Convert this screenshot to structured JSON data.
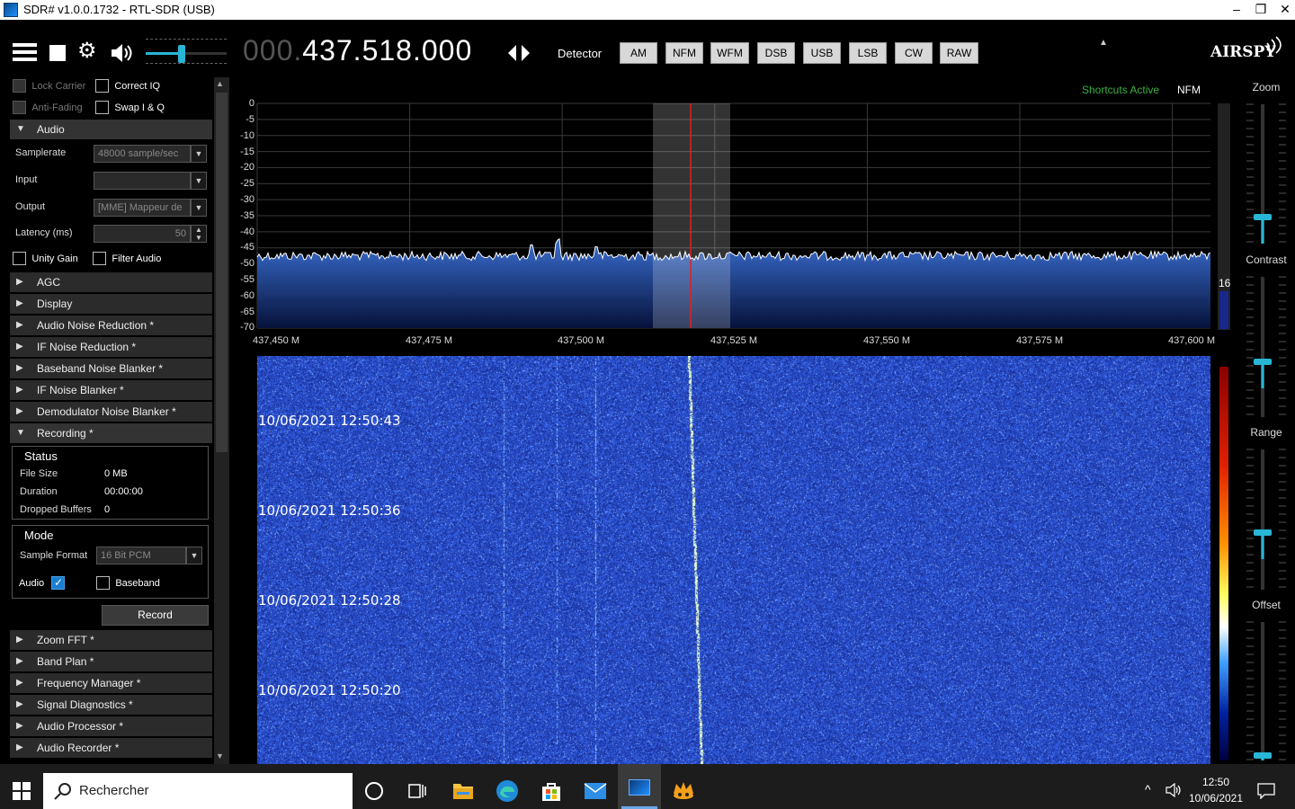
{
  "window": {
    "title": "SDR# v1.0.0.1732 - RTL-SDR (USB)",
    "minimize": "–",
    "restore": "❐",
    "close": "✕"
  },
  "toolbar": {
    "freq_dim": "000.",
    "freq_main": "437.518.000",
    "detector_label": "Detector",
    "modes": [
      "AM",
      "NFM",
      "WFM",
      "DSB",
      "USB",
      "LSB",
      "CW",
      "RAW"
    ],
    "logo": "AIRSPY",
    "volume_level": 0.5
  },
  "left": {
    "lock_carrier": "Lock Carrier",
    "correct_iq": "Correct IQ",
    "anti_fading": "Anti-Fading",
    "swap_iq": "Swap I & Q",
    "audio_header": "Audio",
    "samplerate_label": "Samplerate",
    "samplerate_value": "48000 sample/sec",
    "input_label": "Input",
    "input_value": "",
    "output_label": "Output",
    "output_value": "[MME] Mappeur de",
    "latency_label": "Latency (ms)",
    "latency_value": "50",
    "unity_gain": "Unity Gain",
    "filter_audio": "Filter Audio",
    "sections_a": [
      "AGC",
      "Display",
      "Audio Noise Reduction *",
      "IF Noise Reduction *",
      "Baseband Noise Blanker *",
      "IF Noise Blanker *",
      "Demodulator Noise Blanker *"
    ],
    "recording_header": "Recording *",
    "status_title": "Status",
    "file_size_label": "File Size",
    "file_size_value": "0 MB",
    "duration_label": "Duration",
    "duration_value": "00:00:00",
    "dropped_label": "Dropped Buffers",
    "dropped_value": "0",
    "mode_title": "Mode",
    "sample_format_label": "Sample Format",
    "sample_format_value": "16 Bit PCM",
    "audio_cb": "Audio",
    "baseband_cb": "Baseband",
    "record_button": "Record",
    "sections_b": [
      "Zoom FFT *",
      "Band Plan *",
      "Frequency Manager *",
      "Signal Diagnostics *",
      "Audio Processor *",
      "Audio Recorder *"
    ]
  },
  "spectrum": {
    "shortcuts": "Shortcuts Active",
    "mode": "NFM",
    "y_ticks": [
      "0",
      "-5",
      "-10",
      "-15",
      "-20",
      "-25",
      "-30",
      "-35",
      "-40",
      "-45",
      "-50",
      "-55",
      "-60",
      "-65",
      "-70"
    ],
    "x_ticks": [
      "437,450 M",
      "437,475 M",
      "437,500 M",
      "437,525 M",
      "437,550 M",
      "437,575 M",
      "437,600 M"
    ],
    "side_value": "16"
  },
  "waterfall": {
    "timestamps": [
      "10/06/2021 12:50:43",
      "10/06/2021 12:50:36",
      "10/06/2021 12:50:28",
      "10/06/2021 12:50:20"
    ]
  },
  "right": {
    "zoom": "Zoom",
    "contrast": "Contrast",
    "range": "Range",
    "offset": "Offset"
  },
  "taskbar": {
    "search_placeholder": "Rechercher",
    "time": "12:50",
    "date": "10/06/2021"
  }
}
